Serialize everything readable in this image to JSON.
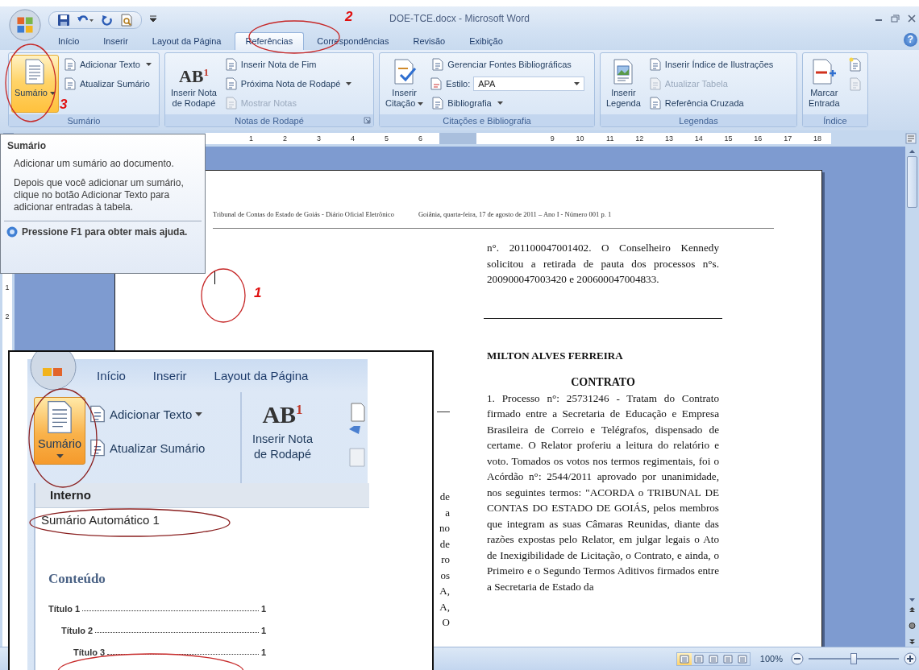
{
  "window": {
    "title": "DOE-TCE.docx - Microsoft Word"
  },
  "tabs": [
    {
      "label": "Início",
      "selected": false
    },
    {
      "label": "Inserir",
      "selected": false
    },
    {
      "label": "Layout da Página",
      "selected": false
    },
    {
      "label": "Referências",
      "selected": true
    },
    {
      "label": "Correspondências",
      "selected": false
    },
    {
      "label": "Revisão",
      "selected": false
    },
    {
      "label": "Exibição",
      "selected": false
    }
  ],
  "help_button": "?",
  "ribbon_groups": [
    {
      "title": "Sumário",
      "items": [
        {
          "kind": "large",
          "label": "Sumário",
          "menu": true,
          "active": true
        },
        {
          "kind": "small",
          "label": "Adicionar Texto",
          "menu": true,
          "disabled": false
        },
        {
          "kind": "small",
          "label": "Atualizar Sumário",
          "disabled": false
        }
      ]
    },
    {
      "title": "Notas de Rodapé",
      "launcher": true,
      "items": [
        {
          "kind": "large",
          "label": "Inserir Nota\nde Rodapé",
          "glyph": "AB$^{1}$",
          "active": false
        },
        {
          "kind": "small",
          "label": "Inserir Nota de Fim",
          "disabled": false
        },
        {
          "kind": "small",
          "label": "Próxima Nota de Rodapé",
          "menu": true,
          "disabled": false
        },
        {
          "kind": "small",
          "label": "Mostrar Notas",
          "disabled": true
        }
      ]
    },
    {
      "title": "Citações e Bibliografia",
      "items": [
        {
          "kind": "large",
          "label": "Inserir\nCitação",
          "menu": true,
          "active": false
        },
        {
          "kind": "small",
          "label": "Gerenciar Fontes Bibliográficas",
          "disabled": false
        },
        {
          "kind": "field",
          "label": "Estilo:",
          "value": "APA"
        },
        {
          "kind": "small",
          "label": "Bibliografia",
          "menu": true,
          "disabled": false
        }
      ]
    },
    {
      "title": "Legendas",
      "items": [
        {
          "kind": "large",
          "label": "Inserir\nLegenda",
          "active": false
        },
        {
          "kind": "small",
          "label": "Inserir Índice de Ilustrações",
          "disabled": false
        },
        {
          "kind": "small",
          "label": "Atualizar Tabela",
          "disabled": true
        },
        {
          "kind": "small",
          "label": "Referência Cruzada",
          "disabled": false
        }
      ]
    },
    {
      "title": "Índice",
      "items": [
        {
          "kind": "large",
          "label": "Marcar\nEntrada",
          "active": false
        },
        {
          "kind": "icon",
          "disabled": false
        },
        {
          "kind": "icon",
          "disabled": true
        }
      ]
    }
  ],
  "ruler": {
    "column_1": [
      "1",
      "2",
      "3",
      "4",
      "5",
      "6"
    ],
    "column_2": [
      "9",
      "10",
      "11",
      "12",
      "13",
      "14",
      "15",
      "16",
      "17",
      "18"
    ]
  },
  "vertical_ruler": [
    "1",
    "2"
  ],
  "tooltip": {
    "title": "Sumário",
    "paragraphs": [
      "Adicionar um sumário ao documento.",
      "Depois que você adicionar um sumário, clique no botão Adicionar Texto para adicionar entradas à tabela."
    ],
    "help": "Pressione F1 para obter mais ajuda."
  },
  "document": {
    "header": [
      "Tribunal de Contas do Estado de Goiás - Diário Oficial Eletrônico",
      "Goiânia, quarta-feira, 17 de agosto de 2011 – Ano I - Número 001   p. 1"
    ],
    "left_column_fragments": [
      "de",
      "a",
      "no",
      "de",
      "ro",
      "os",
      "A,",
      "A,",
      "O"
    ],
    "right_column": [
      {
        "kind": "paragraph",
        "text": "n°. 201100047001402. O Conselheiro Kennedy solicitou a retirada de pauta dos processos n°s. 200900047003420 e 200600047004833."
      },
      {
        "kind": "rule"
      },
      {
        "kind": "heading",
        "text": "MILTON ALVES FERREIRA"
      },
      {
        "kind": "title",
        "text": "CONTRATO"
      },
      {
        "kind": "paragraph",
        "text": "1. Processo n°: 25731246 - Tratam do Contrato firmado entre a Secretaria de Educação e Empresa Brasileira de Correio e Telégrafos, dispensado de certame. O Relator proferiu a leitura do relatório e voto. Tomados os votos nos termos regimentais, foi o Acórdão n°: 2544/2011 aprovado por unanimidade, nos seguintes termos: \"ACORDA o TRIBUNAL DE CONTAS DO ESTADO DE GOIÁS, pelos membros que integram as suas Câmaras Reunidas, diante das razões expostas pelo Relator, em julgar legais o Ato de Inexigibilidade de Licitação, o Contrato, e ainda, o Primeiro e o Segundo Termos Aditivos firmados entre a Secretaria de Estado da"
      }
    ]
  },
  "annotations": [
    "2",
    "3",
    "1"
  ],
  "inset": {
    "tabs": [
      {
        "label": "Início",
        "selected": false
      },
      {
        "label": "Inserir",
        "selected": false
      },
      {
        "label": "Layout da Página",
        "selected": false
      }
    ],
    "groups": [
      {
        "items": [
          {
            "kind": "large",
            "label": "Sumário",
            "menu": true,
            "active": true
          },
          {
            "kind": "small",
            "label": "Adicionar Texto",
            "menu": true
          },
          {
            "kind": "small",
            "label": "Atualizar Sumário"
          }
        ]
      },
      {
        "items": [
          {
            "kind": "large",
            "label": "Inserir Nota\nde Rodapé",
            "glyph": "AB$^{1}$",
            "active": false
          }
        ]
      }
    ],
    "gallery": {
      "section": "Interno",
      "item": "Sumário Automático 1",
      "heading": "Conteúdo",
      "entries": [
        {
          "text": "Título 1",
          "page": "1",
          "children": [
            {
              "text": "Título 2",
              "page": "1",
              "children": [
                {
                  "text": "Título 3",
                  "page": "1"
                }
              ]
            }
          ]
        }
      ]
    }
  },
  "status_bar": {
    "views": [
      {
        "selected": true
      },
      {
        "selected": false
      },
      {
        "selected": false
      },
      {
        "selected": false
      },
      {
        "selected": false
      }
    ],
    "zoom_reading": "100%",
    "zoom_slider": {
      "level": 0.5
    }
  }
}
